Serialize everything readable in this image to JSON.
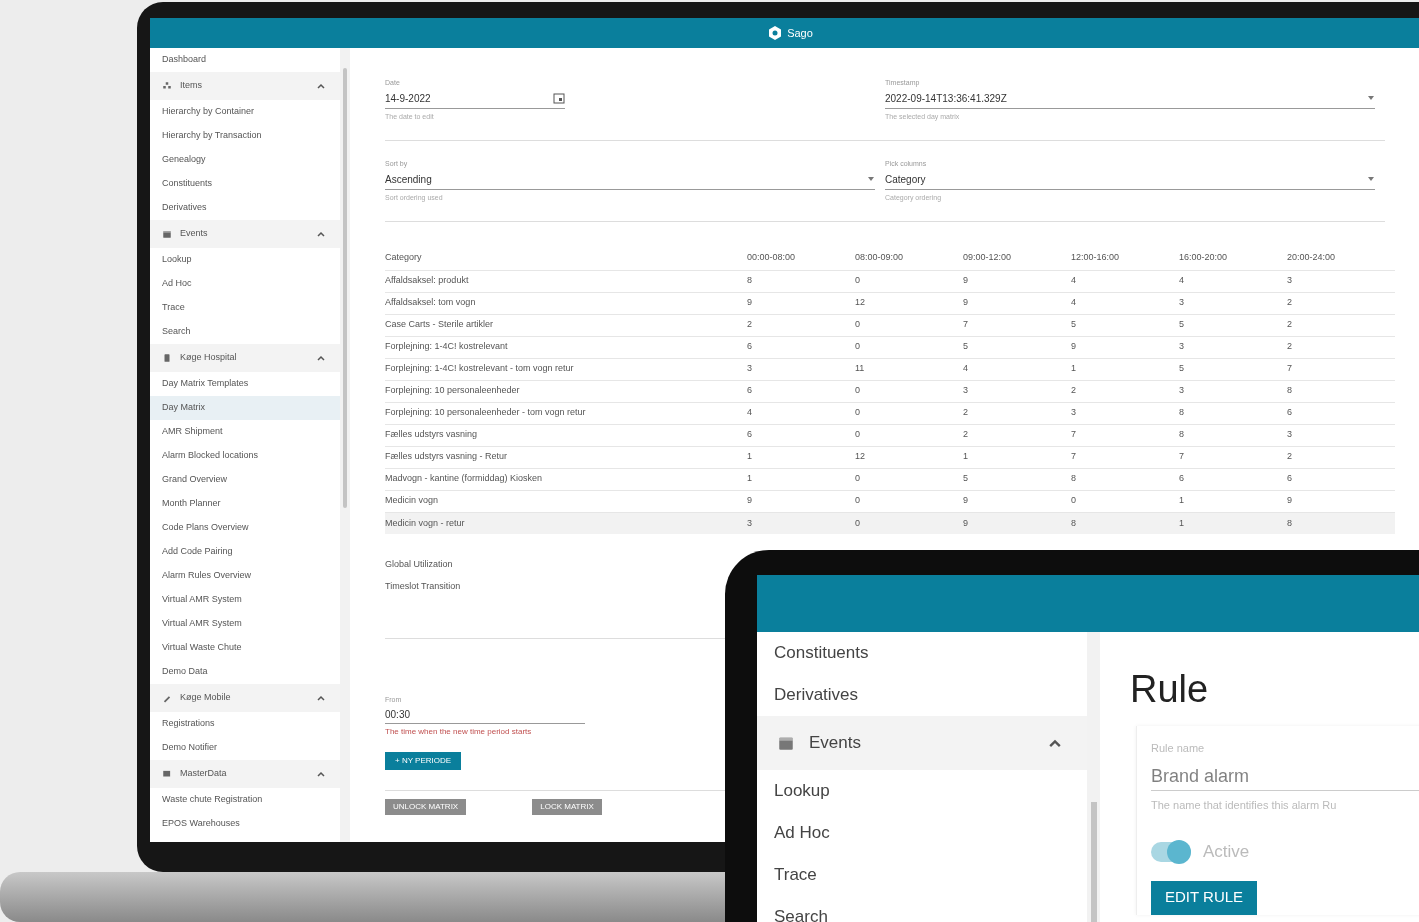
{
  "laptop": {
    "app_bar": {
      "title": "Sago"
    },
    "sidebar": [
      {
        "kind": "link",
        "label": "Dashboard",
        "selected": false
      },
      {
        "kind": "group",
        "label": "Items",
        "expanded": true,
        "children": [
          {
            "label": "Hierarchy by Container",
            "selected": false
          },
          {
            "label": "Hierarchy by Transaction",
            "selected": false
          },
          {
            "label": "Genealogy",
            "selected": false
          },
          {
            "label": "Constituents",
            "selected": false
          },
          {
            "label": "Derivatives",
            "selected": false
          }
        ]
      },
      {
        "kind": "group",
        "label": "Events",
        "expanded": true,
        "children": [
          {
            "label": "Lookup",
            "selected": false
          },
          {
            "label": "Ad Hoc",
            "selected": false
          },
          {
            "label": "Trace",
            "selected": false
          },
          {
            "label": "Search",
            "selected": false
          }
        ]
      },
      {
        "kind": "group",
        "label": "Køge Hospital",
        "expanded": true,
        "children": [
          {
            "label": "Day Matrix Templates",
            "selected": false
          },
          {
            "label": "Day Matrix",
            "selected": true
          },
          {
            "label": "AMR Shipment",
            "selected": false
          },
          {
            "label": "Alarm Blocked locations",
            "selected": false
          },
          {
            "label": "Grand Overview",
            "selected": false
          },
          {
            "label": "Month Planner",
            "selected": false
          },
          {
            "label": "Code Plans Overview",
            "selected": false
          },
          {
            "label": "Add Code Pairing",
            "selected": false
          },
          {
            "label": "Alarm Rules Overview",
            "selected": false
          },
          {
            "label": "Virtual AMR System",
            "selected": false
          },
          {
            "label": "Virtual AMR System",
            "selected": false
          },
          {
            "label": "Virtual Waste Chute",
            "selected": false
          },
          {
            "label": "Demo Data",
            "selected": false
          }
        ]
      },
      {
        "kind": "group",
        "label": "Køge Mobile",
        "expanded": true,
        "children": [
          {
            "label": "Registrations",
            "selected": false
          },
          {
            "label": "Demo Notifier",
            "selected": false
          }
        ]
      },
      {
        "kind": "group",
        "label": "MasterData",
        "expanded": true,
        "children": [
          {
            "label": "Waste chute Registration",
            "selected": false
          },
          {
            "label": "EPOS Warehouses",
            "selected": false
          }
        ]
      }
    ],
    "fields": [
      {
        "kind": "date",
        "label": "Date",
        "value": "14-9-2022",
        "helper": "The date to edit"
      },
      {
        "kind": "select",
        "label": "Timestamp",
        "value": "2022-09-14T13:36:41.329Z",
        "helper": "The selected day matrix"
      },
      {
        "kind": "select",
        "label": "Sort by",
        "value": "Ascending",
        "helper": "Sort ordering used"
      },
      {
        "kind": "select",
        "label": "Pick columns",
        "value": "Category",
        "helper": "Category ordering"
      }
    ],
    "table": {
      "columns": [
        "Category",
        "00:00-08:00",
        "08:00-09:00",
        "09:00-12:00",
        "12:00-16:00",
        "16:00-20:00",
        "20:00-24:00"
      ],
      "rows": [
        {
          "selected": false,
          "cells": [
            "Affaldsaksel: produkt",
            "8",
            "0",
            "9",
            "4",
            "4",
            "3"
          ]
        },
        {
          "selected": false,
          "cells": [
            "Affaldsaksel: tom vogn",
            "9",
            "12",
            "9",
            "4",
            "3",
            "2"
          ]
        },
        {
          "selected": false,
          "cells": [
            "Case Carts - Sterile artikler",
            "2",
            "0",
            "7",
            "5",
            "5",
            "2"
          ]
        },
        {
          "selected": false,
          "cells": [
            "Forplejning: 1-4C! kostrelevant",
            "6",
            "0",
            "5",
            "9",
            "3",
            "2"
          ]
        },
        {
          "selected": false,
          "cells": [
            "Forplejning: 1-4C! kostrelevant - tom vogn retur",
            "3",
            "11",
            "4",
            "1",
            "5",
            "7"
          ]
        },
        {
          "selected": false,
          "cells": [
            "Forplejning: 10 personaleenheder",
            "6",
            "0",
            "3",
            "2",
            "3",
            "8"
          ]
        },
        {
          "selected": false,
          "cells": [
            "Forplejning: 10 personaleenheder - tom vogn retur",
            "4",
            "0",
            "2",
            "3",
            "8",
            "6"
          ]
        },
        {
          "selected": false,
          "cells": [
            "Fælles udstyrs vasning",
            "6",
            "0",
            "2",
            "7",
            "8",
            "3"
          ]
        },
        {
          "selected": false,
          "cells": [
            "Fælles udstyrs vasning - Retur",
            "1",
            "12",
            "1",
            "7",
            "7",
            "2"
          ]
        },
        {
          "selected": false,
          "cells": [
            "Madvogn - kantine (formiddag) Kiosken",
            "1",
            "0",
            "5",
            "8",
            "6",
            "6"
          ]
        },
        {
          "selected": false,
          "cells": [
            "Medicin vogn",
            "9",
            "0",
            "9",
            "0",
            "1",
            "9"
          ]
        },
        {
          "selected": true,
          "cells": [
            "Medicin vogn - retur",
            "3",
            "0",
            "9",
            "8",
            "1",
            "8"
          ]
        }
      ]
    },
    "links": [
      "Global Utilization",
      "Timeslot Transition"
    ],
    "time_field": {
      "label": "From",
      "value": "00:30",
      "helper": "The time when the new time period starts"
    },
    "add_button": "+ NY PERIODE",
    "footer_buttons": [
      "UNLOCK MATRIX",
      "LOCK MATRIX"
    ]
  },
  "tablet": {
    "sidebar": [
      {
        "kind": "link",
        "label": "Constituents"
      },
      {
        "kind": "link",
        "label": "Derivatives"
      },
      {
        "kind": "group",
        "label": "Events",
        "expanded": true
      },
      {
        "kind": "link",
        "label": "Lookup"
      },
      {
        "kind": "link",
        "label": "Ad Hoc"
      },
      {
        "kind": "link",
        "label": "Trace"
      },
      {
        "kind": "link",
        "label": "Search"
      }
    ],
    "heading": "Rule",
    "rule_name": {
      "label": "Rule name",
      "placeholder": "Brand alarm",
      "helper": "The name that identifies this alarm Ru"
    },
    "active_toggle": {
      "label": "Active",
      "on": true
    },
    "edit_button": "EDIT RULE"
  }
}
